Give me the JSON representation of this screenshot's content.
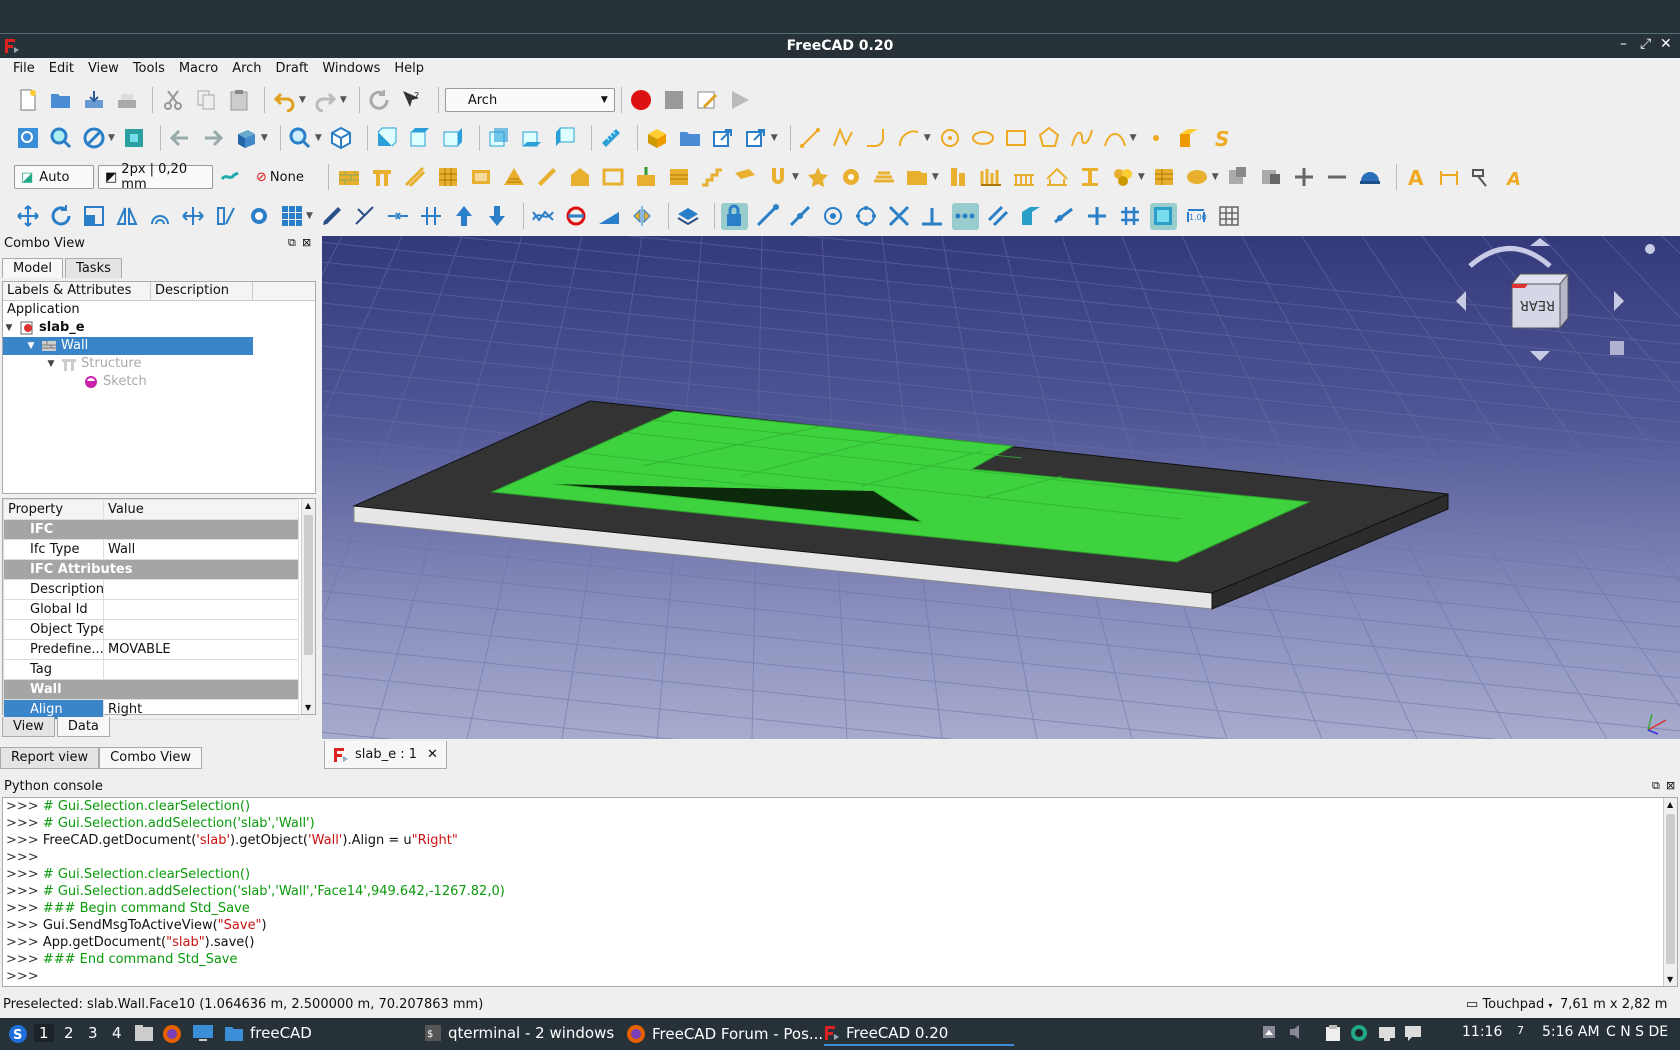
{
  "window": {
    "title": "FreeCAD 0.20"
  },
  "menu": [
    "File",
    "Edit",
    "View",
    "Tools",
    "Macro",
    "Arch",
    "Draft",
    "Windows",
    "Help"
  ],
  "toolbar": {
    "workbench": "Arch",
    "draft_mode": "Auto",
    "line_style": "2px | 0,20 mm",
    "snap_none": "None"
  },
  "combo_view": {
    "title": "Combo View",
    "tabs": [
      "Model",
      "Tasks"
    ],
    "tree_headers": [
      "Labels & Attributes",
      "Description"
    ],
    "tree": {
      "root": "Application",
      "doc": "slab_e",
      "wall": "Wall",
      "structure": "Structure",
      "sketch": "Sketch"
    },
    "prop_headers": [
      "Property",
      "Value"
    ],
    "properties": [
      {
        "group": "IFC"
      },
      {
        "name": "Ifc Type",
        "value": "Wall"
      },
      {
        "group": "IFC Attributes"
      },
      {
        "name": "Description",
        "value": ""
      },
      {
        "name": "Global Id",
        "value": ""
      },
      {
        "name": "Object Type",
        "value": ""
      },
      {
        "name": "Predefine...",
        "value": "MOVABLE"
      },
      {
        "name": "Tag",
        "value": ""
      },
      {
        "group": "Wall"
      },
      {
        "name": "Align",
        "value": "Right",
        "selected": true
      }
    ],
    "prop_tabs": [
      "View",
      "Data"
    ]
  },
  "bottom_tabs": [
    "Report view",
    "Combo View"
  ],
  "doc_tab": "slab_e : 1",
  "navcube": {
    "face": "REAR"
  },
  "python_console": {
    "title": "Python console",
    "lines": [
      [
        {
          "t": ">>> ",
          "c": "p"
        },
        {
          "t": "# Gui.Selection.clearSelection()",
          "c": "cm"
        }
      ],
      [
        {
          "t": ">>> ",
          "c": "p"
        },
        {
          "t": "# Gui.Selection.addSelection('slab','Wall')",
          "c": "cm"
        }
      ],
      [
        {
          "t": ">>> ",
          "c": "p"
        },
        {
          "t": "FreeCAD.getDocument(",
          "c": "rg"
        },
        {
          "t": "'slab'",
          "c": "st"
        },
        {
          "t": ").getObject(",
          "c": "rg"
        },
        {
          "t": "'Wall'",
          "c": "st"
        },
        {
          "t": ").Align = u",
          "c": "rg"
        },
        {
          "t": "\"Right\"",
          "c": "st"
        }
      ],
      [
        {
          "t": ">>> ",
          "c": "p"
        }
      ],
      [
        {
          "t": ">>> ",
          "c": "p"
        },
        {
          "t": "# Gui.Selection.clearSelection()",
          "c": "cm"
        }
      ],
      [
        {
          "t": ">>> ",
          "c": "p"
        },
        {
          "t": "# Gui.Selection.addSelection('slab','Wall','Face14',949.642,-1267.82,0)",
          "c": "cm"
        }
      ],
      [
        {
          "t": ">>> ",
          "c": "p"
        },
        {
          "t": "### Begin command Std_Save",
          "c": "cm"
        }
      ],
      [
        {
          "t": ">>> ",
          "c": "p"
        },
        {
          "t": "Gui.SendMsgToActiveView(",
          "c": "rg"
        },
        {
          "t": "\"Save\"",
          "c": "st"
        },
        {
          "t": ")",
          "c": "rg"
        }
      ],
      [
        {
          "t": ">>> ",
          "c": "p"
        },
        {
          "t": "App.getDocument(",
          "c": "rg"
        },
        {
          "t": "\"slab\"",
          "c": "st"
        },
        {
          "t": ").save()",
          "c": "rg"
        }
      ],
      [
        {
          "t": ">>> ",
          "c": "p"
        },
        {
          "t": "### End command Std_Save",
          "c": "cm"
        }
      ],
      [
        {
          "t": ">>> ",
          "c": "p"
        }
      ]
    ]
  },
  "status": {
    "preselected": "Preselected: slab.Wall.Face10 (1.064636 m, 2.500000 m, 70.207863 mm)",
    "nav_style": "Touchpad",
    "dimensions": "7,61 m x 2,82 m"
  },
  "taskbar": {
    "workspaces": [
      "1",
      "2",
      "3",
      "4"
    ],
    "items": [
      "freeCAD",
      "qterminal - 2 windows",
      "FreeCAD Forum - Pos...",
      "FreeCAD 0.20"
    ],
    "time1": "11:16",
    "num": "7",
    "clock": "5:16 AM",
    "indicators": "C N S DE"
  },
  "colors": {
    "accent": "#3a85c9",
    "face_green": "#3fd23f",
    "dark": "#263238"
  }
}
